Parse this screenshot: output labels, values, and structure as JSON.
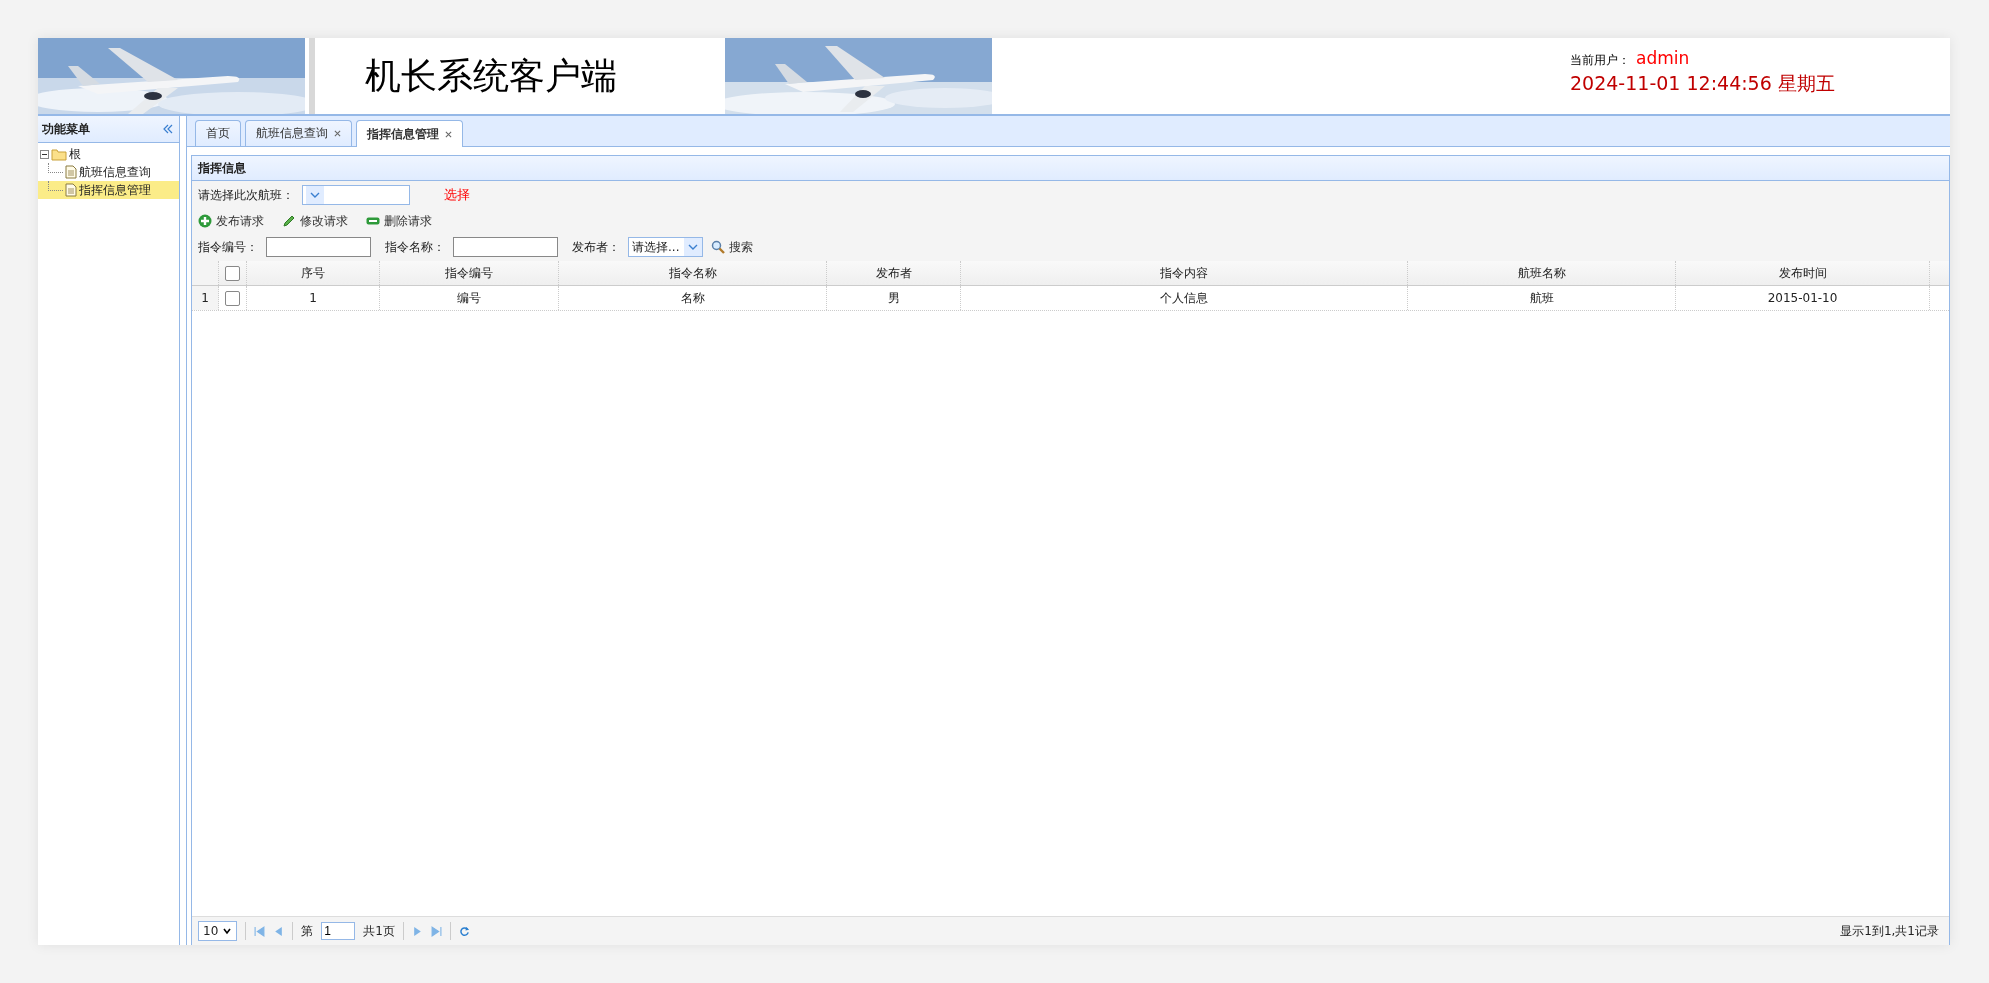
{
  "header": {
    "title": "机长系统客户端",
    "user_label": "当前用户：",
    "user": "admin",
    "datetime": "2024-11-01 12:44:56 星期五"
  },
  "sidebar": {
    "title": "功能菜单",
    "tree": [
      {
        "label": "根",
        "expanded": true,
        "children": [
          {
            "label": "航班信息查询",
            "selected": false
          },
          {
            "label": "指挥信息管理",
            "selected": true
          }
        ]
      }
    ]
  },
  "tabs": [
    {
      "label": "首页",
      "closable": false,
      "selected": false
    },
    {
      "label": "航班信息查询",
      "closable": true,
      "selected": false
    },
    {
      "label": "指挥信息管理",
      "closable": true,
      "selected": true
    }
  ],
  "panel": {
    "title": "指挥信息",
    "flight_label": "请选择此次航班：",
    "select_link": "选择",
    "actions": [
      {
        "label": "发布请求",
        "kind": "add"
      },
      {
        "label": "修改请求",
        "kind": "edit"
      },
      {
        "label": "删除请求",
        "kind": "remove"
      }
    ],
    "filters": [
      {
        "label": "指令编号：",
        "kind": "text"
      },
      {
        "label": "指令名称：",
        "kind": "text"
      },
      {
        "label": "发布者：",
        "kind": "select",
        "placeholder": "请选择..."
      }
    ],
    "search": "搜索"
  },
  "table": {
    "select_all_checked": false,
    "columns": [
      "序号",
      "指令编号",
      "指令名称",
      "发布者",
      "指令内容",
      "航班名称",
      "发布时间"
    ],
    "rows": [
      {
        "number": "1",
        "checked": false,
        "cells": [
          "1",
          "编号",
          "名称",
          "男",
          "个人信息",
          "航班",
          "2015-01-10"
        ]
      }
    ]
  },
  "pager": {
    "page_size": "10",
    "page_prefix": "第",
    "page": "1",
    "page_total": "共1页",
    "summary": "显示1到1,共1记录"
  }
}
